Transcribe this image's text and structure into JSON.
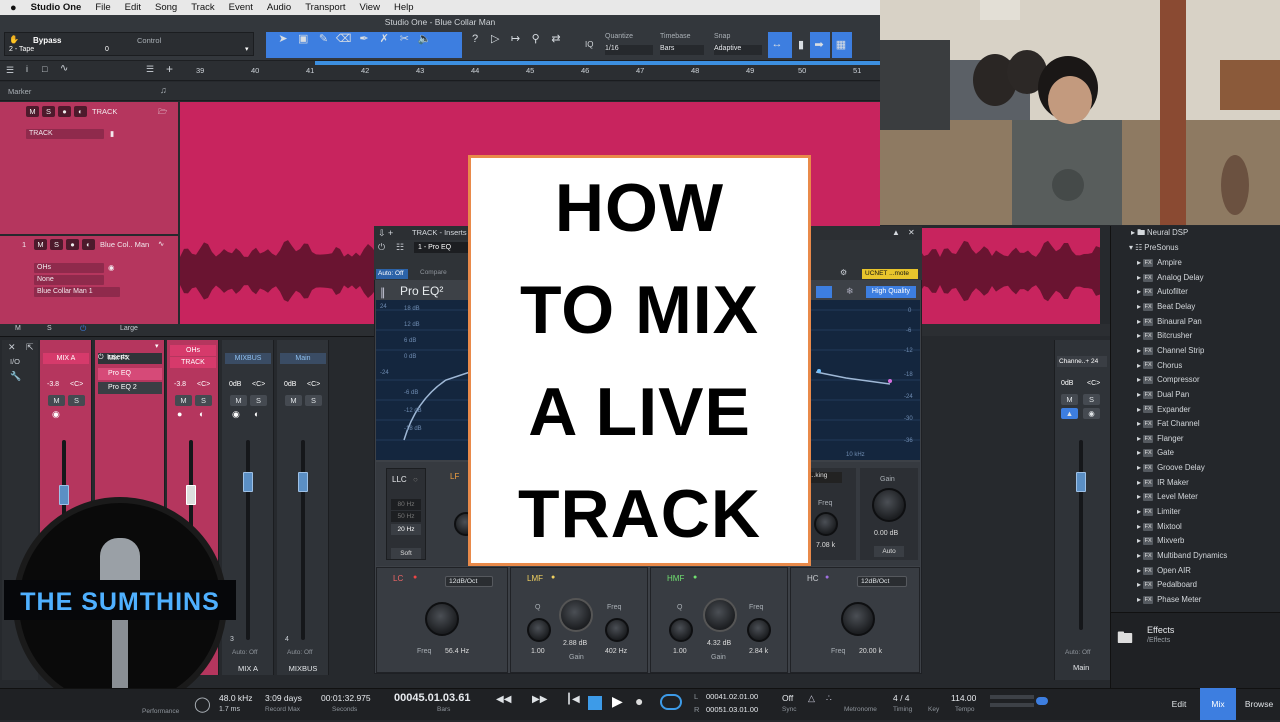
{
  "menubar": {
    "apple": "",
    "app_name": "Studio One",
    "items": [
      "File",
      "Edit",
      "Song",
      "Track",
      "Event",
      "Audio",
      "Transport",
      "View",
      "Help"
    ]
  },
  "window_title": "Studio One - Blue Collar Man",
  "toolbar": {
    "track_name": "2 - Tape",
    "bypass_label": "Bypass",
    "control_label": "Control",
    "channel_value": "0",
    "quantize_label": "Quantize",
    "quantize_value": "1/16",
    "timebase_label": "Timebase",
    "timebase_value": "Bars",
    "snap_label": "Snap",
    "snap_value": "Adaptive",
    "iq_label": "IQ"
  },
  "ruler": {
    "bars": [
      "39",
      "40",
      "41",
      "42",
      "43",
      "44",
      "45",
      "46",
      "47",
      "48",
      "49",
      "50",
      "51"
    ]
  },
  "marker_label": "Marker",
  "tracks": [
    {
      "number": "",
      "name": "TRACK",
      "dropdown": "TRACK"
    },
    {
      "number": "1",
      "name": "Blue Col.. Man",
      "sub1": "OHs",
      "sub2": "None",
      "sub3": "Blue Collar Man 1"
    }
  ],
  "track_footer": {
    "m": "M",
    "s": "S",
    "size": "Large"
  },
  "mixer": {
    "io_label": "I/O",
    "strips": [
      {
        "name": "MIX A",
        "vol": "-3.8",
        "pan": "<C>",
        "bottom": "",
        "selected": true
      },
      {
        "name": "Mix FX",
        "vol": "",
        "pan": "",
        "bottom": "",
        "selected": true
      },
      {
        "name": "OHs / TRACK",
        "vol": "-3.8",
        "pan": "<C>",
        "bottom": "",
        "selected": true
      },
      {
        "name": "MIXBUS",
        "vol": "0dB",
        "pan": "<C>",
        "bottom": "MIX A",
        "selected": false
      },
      {
        "name": "Main",
        "vol": "0dB",
        "pan": "<C>",
        "bottom": "MIXBUS",
        "selected": false
      }
    ],
    "inserts_label": "Inserts",
    "insert_items": [
      "Pro EQ",
      "Pro EQ 2"
    ],
    "auto_off": "Auto: Off",
    "strip3_number": "3",
    "strip4_number": "4",
    "main_bottom": "Main",
    "channel_right": "Channe..+ 24",
    "right_vol": "0dB",
    "right_pan": "<C>",
    "right_bottom": "Main",
    "right_auto": "Auto: Off"
  },
  "plugin": {
    "title": "TRACK - Inserts",
    "preset": "1 - Pro EQ",
    "auto_off": "Auto: Off",
    "compare": "Compare",
    "name": "Pro EQ²",
    "side_chain": "UCNET ...mote",
    "high_quality": "High Quality",
    "db_labels": [
      "24",
      "18 dB",
      "12 dB",
      "6 dB",
      "0 dB",
      "-6 dB",
      "-12 dB",
      "-18 dB",
      "-24"
    ],
    "right_db": [
      "0",
      "-6",
      "-12",
      "-18",
      "-24",
      "-30",
      "-36"
    ],
    "freq_label": "10 kHz",
    "llc": {
      "title": "LLC",
      "freqs": [
        "80 Hz",
        "50 Hz",
        "20 Hz"
      ],
      "soft": "Soft"
    },
    "lf_title": "LF",
    "hf_freq_label": "Freq",
    "hf_freq_value": "7.08 k",
    "gain_label": "Gain",
    "gain_value": "0.00 dB",
    "auto_label": "Auto",
    "bands": [
      {
        "title": "LC",
        "slope": "12dB/Oct",
        "freq_label": "Freq",
        "freq": "56.4 Hz"
      },
      {
        "title": "LMF",
        "q_label": "Q",
        "q": "1.00",
        "gain": "2.88 dB",
        "gain_label": "Gain",
        "freq_label": "Freq",
        "freq": "402 Hz"
      },
      {
        "title": "HMF",
        "q_label": "Q",
        "q": "1.00",
        "gain": "4.32 dB",
        "gain_label": "Gain",
        "freq_label": "Freq",
        "freq": "2.84 k"
      },
      {
        "title": "HC",
        "slope": "12dB/Oct",
        "freq_label": "Freq",
        "freq": "20.00 k"
      }
    ],
    "shelving": "...king"
  },
  "thumbnail_text": [
    "HOW",
    "TO MIX",
    "A LIVE",
    "TRACK"
  ],
  "logo_text": "THE SUMTHINS",
  "browser": {
    "top_items": [
      "Neural DSP",
      "PreSonus"
    ],
    "effects": [
      "Ampire",
      "Analog Delay",
      "Autofilter",
      "Beat Delay",
      "Binaural Pan",
      "Bitcrusher",
      "Channel Strip",
      "Chorus",
      "Compressor",
      "Dual Pan",
      "Expander",
      "Fat Channel",
      "Flanger",
      "Gate",
      "Groove Delay",
      "IR Maker",
      "Level Meter",
      "Limiter",
      "Mixtool",
      "Mixverb",
      "Multiband Dynamics",
      "Open AIR",
      "Pedalboard",
      "Phase Meter"
    ],
    "fx_badge": "FX",
    "footer_title": "Effects",
    "footer_path": "/Effects"
  },
  "transport": {
    "sample_rate": "48.0 kHz",
    "latency": "1.7 ms",
    "record_max": "3:09 days",
    "record_max_label": "Record Max",
    "seconds": "00:01:32.975",
    "seconds_label": "Seconds",
    "bars": "00045.01.03.61",
    "bars_label": "Bars",
    "performance_label": "Performance",
    "loop_l_label": "L",
    "loop_l": "00041.02.01.00",
    "loop_r_label": "R",
    "loop_r": "00051.03.01.00",
    "sync": "Off",
    "sync_label": "Sync",
    "metronome_label": "Metronome",
    "timing": "4 / 4",
    "timing_label": "Timing",
    "key_label": "Key",
    "tempo": "114.00",
    "tempo_label": "Tempo"
  },
  "page_buttons": {
    "edit": "Edit",
    "mix": "Mix",
    "browse": "Browse"
  },
  "colors": {
    "track": "#c8245e",
    "accent": "#3d7ee0",
    "thumbnail_border": "#e98a4a"
  }
}
